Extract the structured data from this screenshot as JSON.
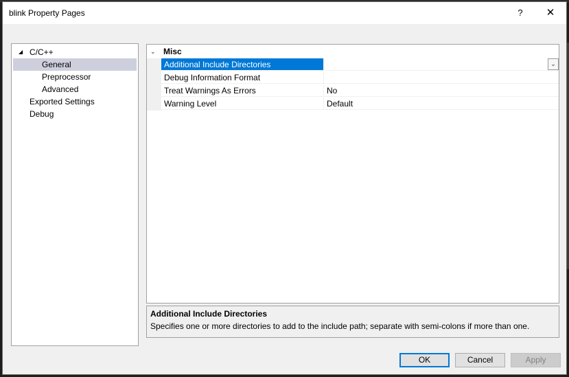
{
  "window": {
    "title": "blink Property Pages",
    "help_glyph": "?",
    "close_glyph": "✕"
  },
  "tree": {
    "items": [
      {
        "label": "C/C++",
        "expanded": true,
        "expander": "◢"
      },
      {
        "label": "General",
        "selected": true
      },
      {
        "label": "Preprocessor"
      },
      {
        "label": "Advanced"
      },
      {
        "label": "Exported Settings"
      },
      {
        "label": "Debug"
      }
    ]
  },
  "grid": {
    "category": {
      "label": "Misc",
      "chevron": "⌄"
    },
    "rows": [
      {
        "name": "Additional Include Directories",
        "value": "",
        "selected": true
      },
      {
        "name": "Debug Information Format",
        "value": ""
      },
      {
        "name": "Treat Warnings As Errors",
        "value": "No"
      },
      {
        "name": "Warning Level",
        "value": "Default"
      }
    ],
    "dropdown_glyph": "⌄"
  },
  "description": {
    "title": "Additional Include Directories",
    "text": "Specifies one or more directories to add to the include path; separate with semi-colons if more than one."
  },
  "buttons": {
    "ok": "OK",
    "cancel": "Cancel",
    "apply": "Apply"
  },
  "colors": {
    "selection": "#0078d7",
    "tree_selection": "#cdd0dc",
    "dialog_bg": "#f0f0f0"
  }
}
